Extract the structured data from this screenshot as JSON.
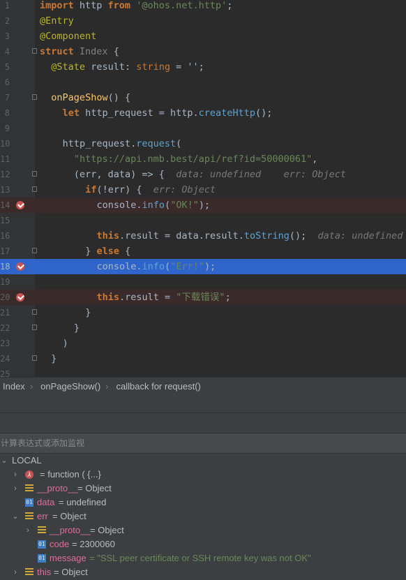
{
  "editor": {
    "lines": [
      {
        "n": "1",
        "parts": [
          [
            "kw",
            "import"
          ],
          [
            "",
            "http"
          ],
          [
            "kw",
            "from"
          ],
          [
            "str",
            "'@ohos.net.http'"
          ],
          [
            "",
            ";"
          ]
        ]
      },
      {
        "n": "2",
        "parts": [
          [
            "ann",
            "@Entry"
          ]
        ]
      },
      {
        "n": "3",
        "parts": [
          [
            "ann",
            "@Component"
          ]
        ]
      },
      {
        "n": "4",
        "parts": [
          [
            "kw",
            "struct"
          ],
          [
            "cls",
            "Index"
          ],
          [
            "",
            "{"
          ]
        ]
      },
      {
        "n": "5",
        "parts": [
          [
            "ann",
            "@State"
          ],
          [
            "",
            "result:"
          ],
          [
            "kwn",
            "string"
          ],
          [
            "",
            "= '';"
          ]
        ]
      },
      {
        "n": "6",
        "parts": []
      },
      {
        "n": "7",
        "parts": [
          [
            "fn",
            "onPageShow"
          ],
          [
            "",
            "() {"
          ]
        ]
      },
      {
        "n": "8",
        "parts": [
          [
            "kw",
            "let"
          ],
          [
            "",
            "http_request = http."
          ],
          [
            "call",
            "createHttp"
          ],
          [
            "",
            "();"
          ]
        ]
      },
      {
        "n": "9",
        "parts": []
      },
      {
        "n": "10",
        "parts": [
          [
            "",
            "http_request."
          ],
          [
            "call",
            "request"
          ],
          [
            "",
            "("
          ]
        ]
      },
      {
        "n": "11",
        "parts": [
          [
            "str",
            "\"https://api.nmb.best/api/ref?id=50000061\""
          ],
          [
            "",
            ","
          ]
        ]
      },
      {
        "n": "12",
        "parts": [
          [
            "",
            "(err, data) => {"
          ],
          [
            "hint",
            "data: undefined    err: Object"
          ]
        ]
      },
      {
        "n": "13",
        "parts": [
          [
            "kw",
            "if"
          ],
          [
            "",
            "(!err) {"
          ],
          [
            "hint",
            "err: Object"
          ]
        ]
      },
      {
        "n": "14",
        "parts": [
          [
            "",
            "console."
          ],
          [
            "call",
            "info"
          ],
          [
            "",
            "("
          ],
          [
            "str",
            "\"OK!\""
          ],
          [
            "",
            ");"
          ]
        ]
      },
      {
        "n": "15",
        "parts": []
      },
      {
        "n": "16",
        "parts": [
          [
            "kw",
            "this"
          ],
          [
            "",
            ".result = data.result."
          ],
          [
            "call",
            "toString"
          ],
          [
            "",
            "();"
          ],
          [
            "hint",
            "data: undefined"
          ]
        ]
      },
      {
        "n": "17",
        "parts": [
          [
            "",
            "} "
          ],
          [
            "kw",
            "else"
          ],
          [
            "",
            "{"
          ]
        ]
      },
      {
        "n": "18",
        "parts": [
          [
            "",
            "console."
          ],
          [
            "call",
            "info"
          ],
          [
            "",
            "("
          ],
          [
            "str",
            "\"Err!\""
          ],
          [
            "",
            ");"
          ]
        ]
      },
      {
        "n": "19",
        "parts": []
      },
      {
        "n": "20",
        "parts": [
          [
            "kw",
            "this"
          ],
          [
            "",
            ".result = "
          ],
          [
            "str",
            "\"下载错误\""
          ],
          [
            "",
            ";"
          ]
        ]
      },
      {
        "n": "21",
        "parts": [
          [
            "",
            "}"
          ]
        ]
      },
      {
        "n": "22",
        "parts": [
          [
            "",
            "}"
          ]
        ]
      },
      {
        "n": "23",
        "parts": [
          [
            "",
            ")"
          ]
        ]
      },
      {
        "n": "24",
        "parts": [
          [
            "",
            "}"
          ]
        ]
      },
      {
        "n": "25",
        "parts": []
      }
    ]
  },
  "breadcrumb": {
    "items": [
      "Index",
      "onPageShow()",
      "callback for request()"
    ]
  },
  "watch": {
    "placeholder": "计算表达式或添加监视"
  },
  "variables": {
    "rows": [
      {
        "label": "LOCAL",
        "name": "",
        "value": ""
      },
      {
        "label": "",
        "name": "",
        "value": "= function ( {...}"
      },
      {
        "label": "",
        "name": "__proto__",
        "value": "= Object"
      },
      {
        "label": "",
        "name": "data",
        "value": "= undefined"
      },
      {
        "label": "",
        "name": "err",
        "value": "= Object"
      },
      {
        "label": "",
        "name": "__proto__",
        "value": "= Object"
      },
      {
        "label": "",
        "name": "code",
        "value": "= 2300060"
      },
      {
        "label": "",
        "name": "message",
        "value": "= \"SSL peer certificate or SSH remote key was not OK\""
      },
      {
        "label": "",
        "name": "this",
        "value": "= Object"
      }
    ]
  }
}
